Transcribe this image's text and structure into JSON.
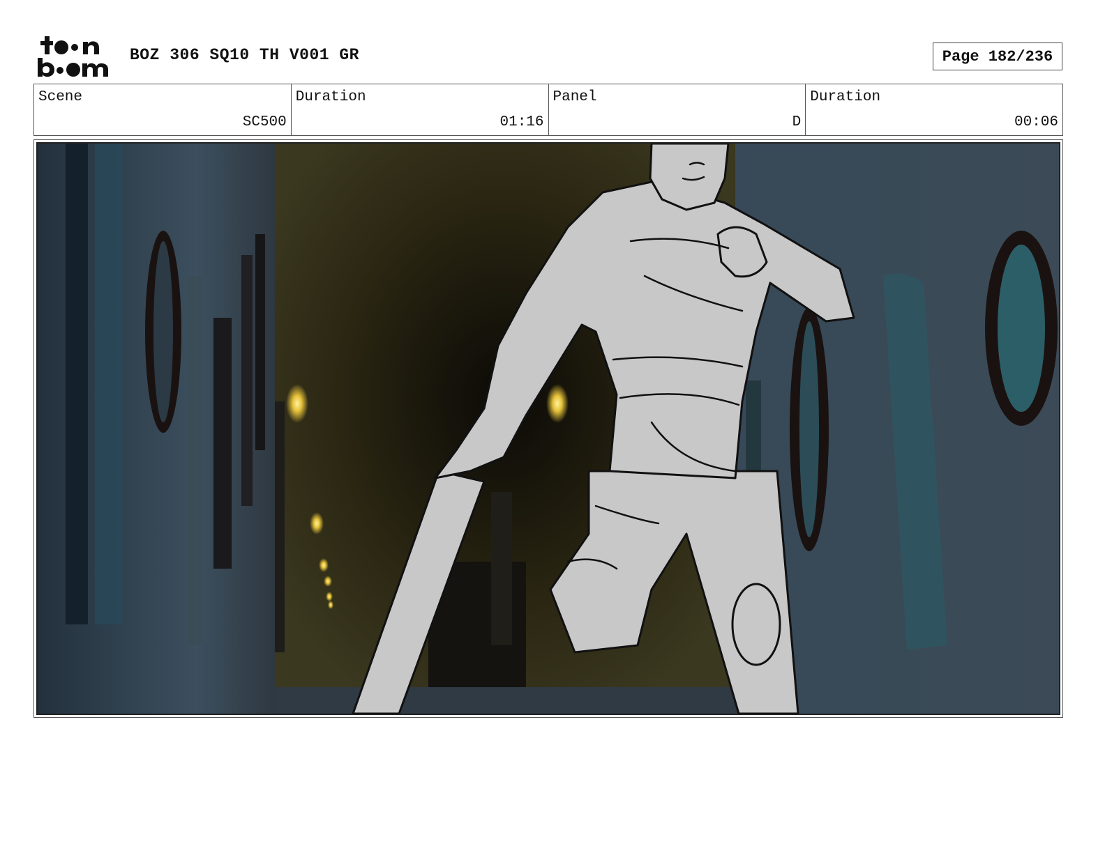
{
  "header": {
    "logo_text": "toon boom",
    "project": "BOZ 306 SQ10 TH V001 GR",
    "page": "Page 182/236"
  },
  "info": {
    "scene_label": "Scene",
    "scene_value": "SC500",
    "scene_duration_label": "Duration",
    "scene_duration_value": "01:16",
    "panel_label": "Panel",
    "panel_value": "D",
    "panel_duration_label": "Duration",
    "panel_duration_value": "00:06"
  }
}
